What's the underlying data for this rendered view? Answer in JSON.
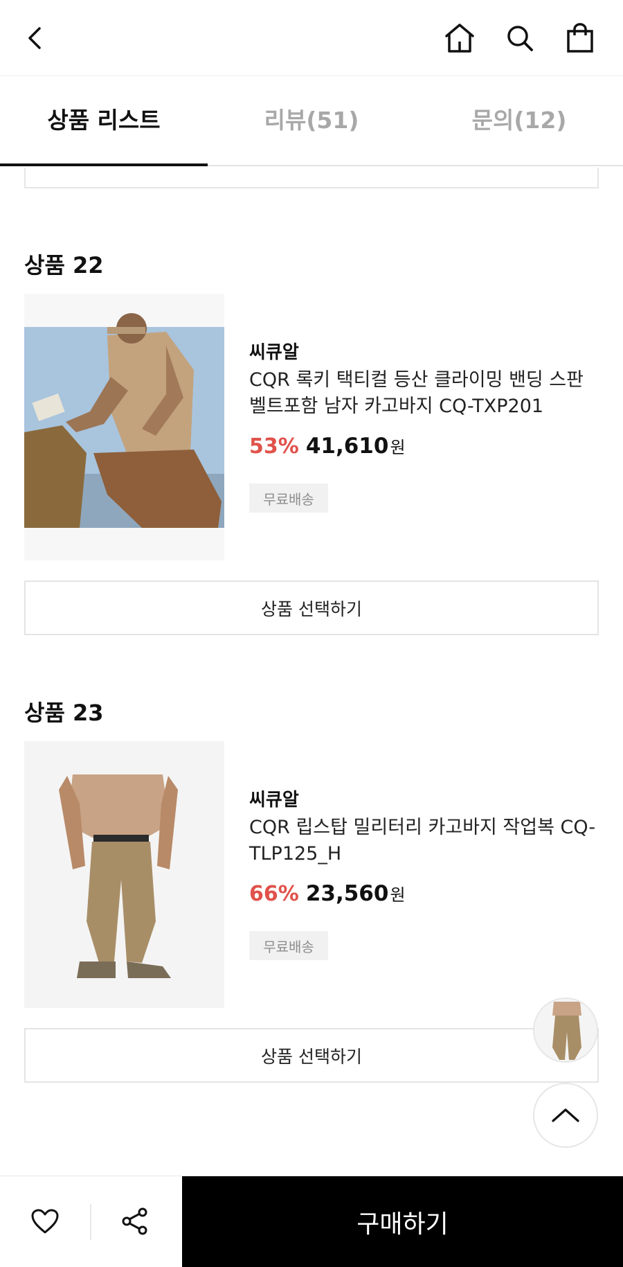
{
  "header": {
    "back_icon": "chevron-left-icon",
    "home_icon": "home-icon",
    "search_icon": "search-icon",
    "cart_icon": "shopping-bag-icon"
  },
  "tabs": [
    {
      "label": "상품 리스트",
      "active": true
    },
    {
      "label": "리뷰(51)",
      "active": false
    },
    {
      "label": "문의(12)",
      "active": false
    }
  ],
  "products": [
    {
      "title": "상품 22",
      "brand": "씨큐알",
      "name": "CQR 록키 택티컬 등산 클라이밍 밴딩 스판 벨트포함 남자 카고바지 CQ-TXP201",
      "discount": "53%",
      "price": "41,610",
      "currency": "원",
      "badge": "무료배송",
      "select_label": "상품 선택하기"
    },
    {
      "title": "상품 23",
      "brand": "씨큐알",
      "name": "CQR 립스탑 밀리터리 카고바지 작업복 CQ-TLP125_H",
      "discount": "66%",
      "price": "23,560",
      "currency": "원",
      "badge": "무료배송",
      "select_label": "상품 선택하기"
    }
  ],
  "floating": {
    "thumb_alt": "product-thumbnail",
    "top_icon": "chevron-up-icon"
  },
  "bottom_bar": {
    "like_icon": "heart-icon",
    "share_icon": "share-icon",
    "buy_label": "구매하기"
  },
  "colors": {
    "discount": "#e0524b",
    "buy_button": "#000000",
    "badge_bg": "#f1f1f1"
  }
}
